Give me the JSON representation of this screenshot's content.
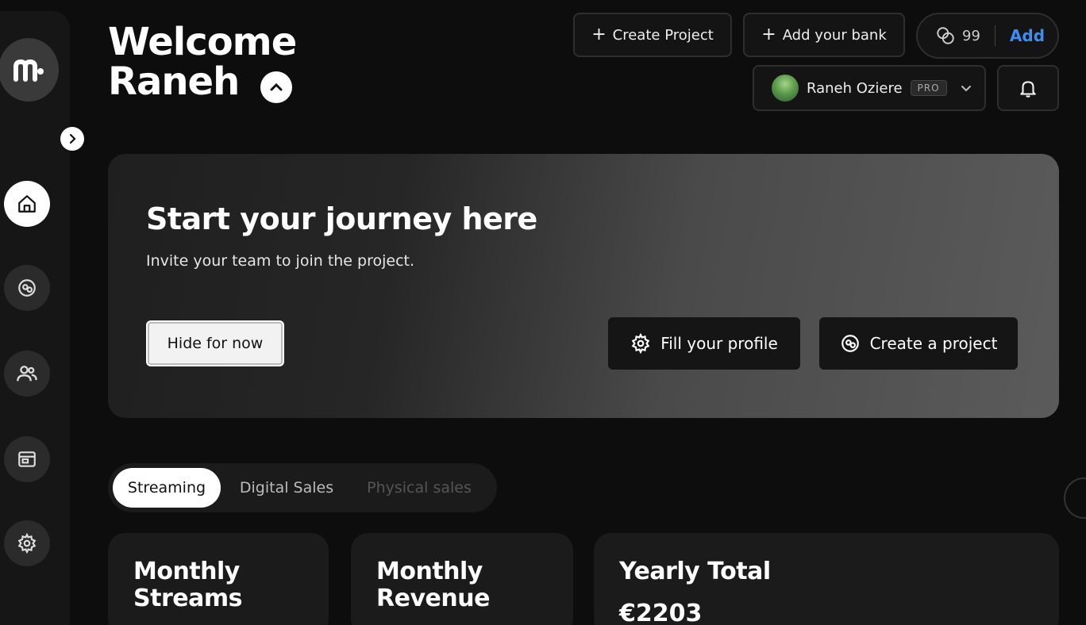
{
  "app": {
    "logo_text": "m",
    "welcome_line1": "Welcome",
    "welcome_line2": "Raneh"
  },
  "header": {
    "create_project_label": "Create Project",
    "add_bank_label": "Add your bank",
    "credits_count": "99",
    "credits_add_label": "Add",
    "user_name": "Raneh Oziere",
    "user_badge": "PRO"
  },
  "sidebar": {
    "items": [
      {
        "icon": "home-icon",
        "active": true
      },
      {
        "icon": "projects-icon",
        "active": false
      },
      {
        "icon": "users-icon",
        "active": false
      },
      {
        "icon": "wallet-icon",
        "active": false
      },
      {
        "icon": "gear-icon",
        "active": false
      }
    ]
  },
  "hero": {
    "title": "Start your journey here",
    "subtitle": "Invite your team to join the project.",
    "hide_label": "Hide for now",
    "fill_profile_label": "Fill your profile",
    "create_project_label": "Create a project"
  },
  "tabs": [
    {
      "label": "Streaming",
      "active": true
    },
    {
      "label": "Digital Sales",
      "active": false
    },
    {
      "label": "Physical sales",
      "active": false
    }
  ],
  "cards": [
    {
      "line1": "Monthly",
      "line2": "Streams",
      "value": ""
    },
    {
      "line1": "Monthly",
      "line2": "Revenue",
      "value": ""
    },
    {
      "line1": "Yearly Total",
      "line2": "",
      "value": "€2203"
    }
  ],
  "colors": {
    "accent": "#3a8ef6",
    "background": "#0d0d0d",
    "surface": "#1b1b1b"
  }
}
